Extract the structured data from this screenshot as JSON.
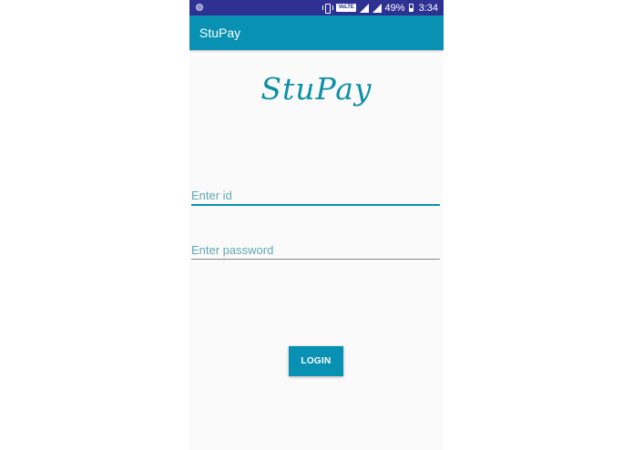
{
  "status_bar": {
    "volte": "VoLTE",
    "battery": "49%",
    "time": "3:34"
  },
  "app_bar": {
    "title": "StuPay"
  },
  "logo": {
    "text": "StuPay"
  },
  "form": {
    "id_placeholder": "Enter id",
    "password_placeholder": "Enter password",
    "login_label": "LOGIN"
  },
  "colors": {
    "status_bar": "#2e3192",
    "primary": "#0891b2",
    "background": "#fafafa"
  }
}
